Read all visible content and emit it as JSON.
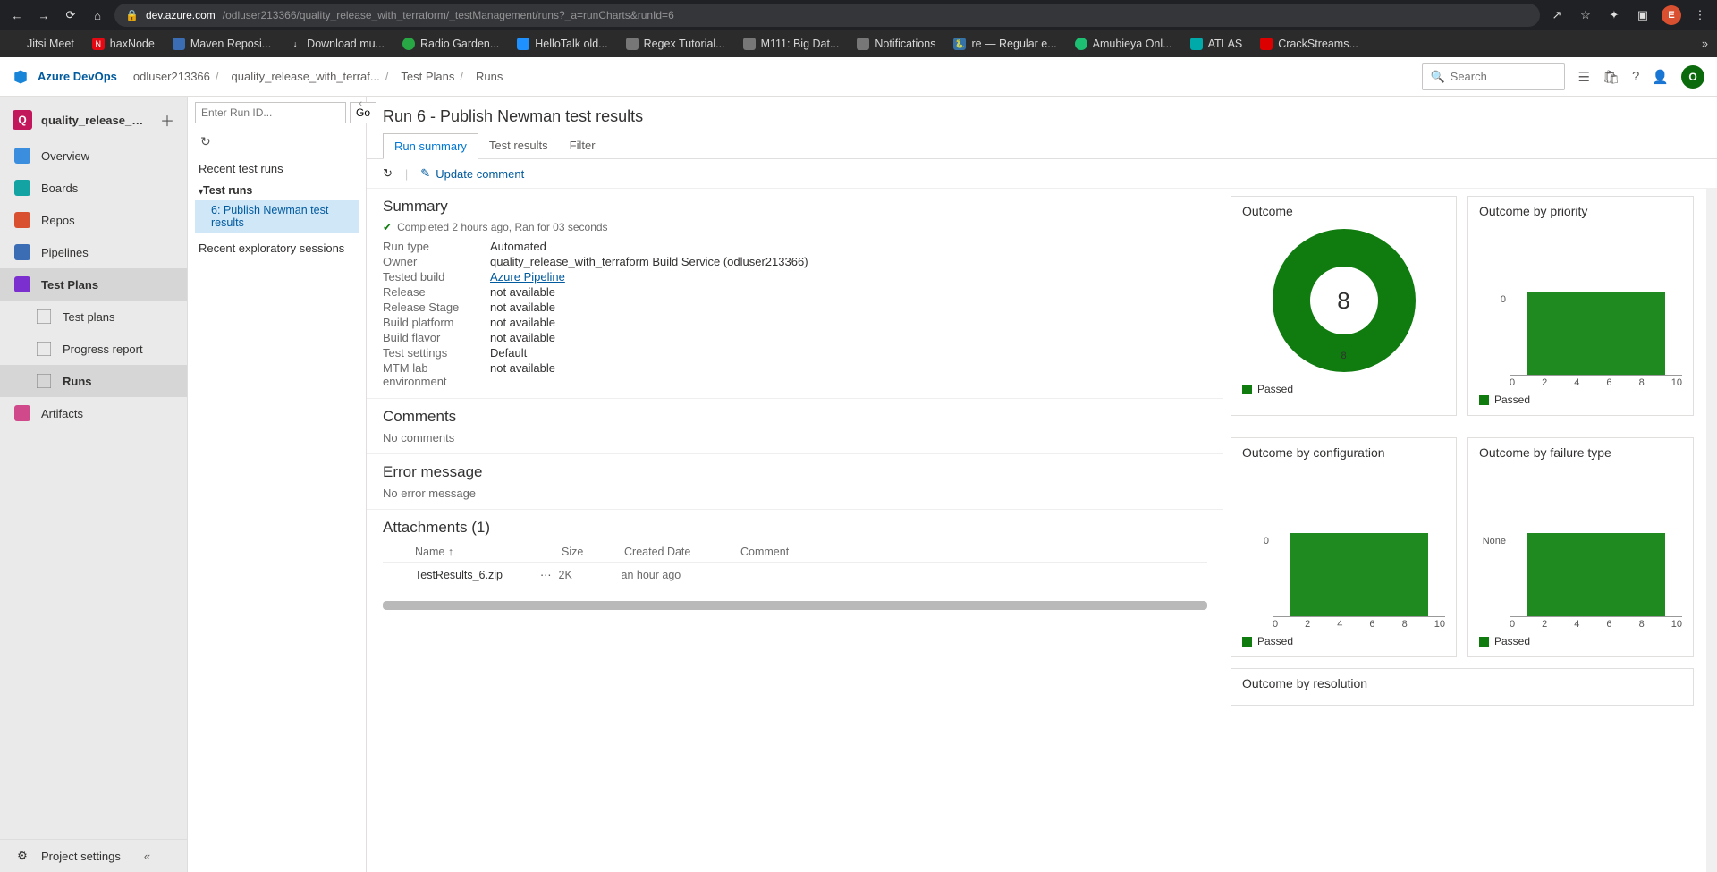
{
  "browser": {
    "url_host": "dev.azure.com",
    "url_path": "/odluser213366/quality_release_with_terraform/_testManagement/runs?_a=runCharts&runId=6",
    "avatar": "E"
  },
  "bookmarks": [
    {
      "label": "Jitsi Meet",
      "color": "#2b2b2b"
    },
    {
      "label": "haxNode",
      "color": "#e50914",
      "prefix": "N"
    },
    {
      "label": "Maven Reposi...",
      "color": "#3b6db5"
    },
    {
      "label": "Download mu...",
      "color": "#2b2b2b",
      "prefix": "↓"
    },
    {
      "label": "Radio Garden...",
      "color": "#28a745",
      "round": true
    },
    {
      "label": "HelloTalk old...",
      "color": "#1e90ff"
    },
    {
      "label": "Regex Tutorial...",
      "color": "#777"
    },
    {
      "label": "M111: Big Dat...",
      "color": "#777"
    },
    {
      "label": "Notifications",
      "color": "#777"
    },
    {
      "label": "re — Regular e...",
      "color": "#3572A5",
      "prefix": "🐍"
    },
    {
      "label": "Amubieya Onl...",
      "color": "#1dbf73",
      "round": true
    },
    {
      "label": "ATLAS",
      "color": "#0aa"
    },
    {
      "label": "CrackStreams...",
      "color": "#d00"
    }
  ],
  "header": {
    "brand": "Azure DevOps",
    "crumbs": [
      "odluser213366",
      "quality_release_with_terraf...",
      "Test Plans",
      "Runs"
    ],
    "search_placeholder": "Search",
    "avatar": "O"
  },
  "sidebar": {
    "project": "quality_release_with_t...",
    "project_initial": "Q",
    "items": [
      {
        "label": "Overview",
        "icon": "overview"
      },
      {
        "label": "Boards",
        "icon": "boards"
      },
      {
        "label": "Repos",
        "icon": "repos"
      },
      {
        "label": "Pipelines",
        "icon": "pipelines"
      },
      {
        "label": "Test Plans",
        "icon": "testplans",
        "selected": true,
        "children": [
          {
            "label": "Test plans"
          },
          {
            "label": "Progress report"
          },
          {
            "label": "Runs",
            "selected": true
          }
        ]
      },
      {
        "label": "Artifacts",
        "icon": "artifacts"
      }
    ],
    "settings": "Project settings"
  },
  "runsPanel": {
    "placeholder": "Enter Run ID...",
    "go": "Go",
    "recent": "Recent test runs",
    "sect": "Test runs",
    "item": "6: Publish Newman test results",
    "exploratory": "Recent exploratory sessions"
  },
  "page": {
    "title": "Run 6 - Publish Newman test results",
    "tabs": [
      "Run summary",
      "Test results",
      "Filter"
    ],
    "update": "Update comment",
    "summaryTitle": "Summary",
    "status": "Completed 2 hours ago, Ran for 03 seconds",
    "kv": [
      {
        "k": "Run type",
        "v": "Automated"
      },
      {
        "k": "Owner",
        "v": "quality_release_with_terraform Build Service (odluser213366)"
      },
      {
        "k": "Tested build",
        "v": "Azure Pipeline",
        "link": true
      },
      {
        "k": "Release",
        "v": "not available"
      },
      {
        "k": "Release Stage",
        "v": "not available"
      },
      {
        "k": "Build platform",
        "v": "not available"
      },
      {
        "k": "Build flavor",
        "v": "not available"
      },
      {
        "k": "Test settings",
        "v": "Default"
      },
      {
        "k": "MTM lab environment",
        "v": "not available"
      }
    ],
    "commentsTitle": "Comments",
    "commentsEmpty": "No comments",
    "errorTitle": "Error message",
    "errorEmpty": "No error message",
    "attTitle": "Attachments (1)",
    "attCols": {
      "name": "Name ↑",
      "size": "Size",
      "date": "Created Date",
      "comm": "Comment"
    },
    "attRows": [
      {
        "name": "TestResults_6.zip",
        "size": "2K",
        "date": "an hour ago",
        "comm": ""
      }
    ]
  },
  "charts": {
    "outcome": {
      "title": "Outcome",
      "total": "8",
      "label": "8",
      "legend": "Passed"
    },
    "priority": {
      "title": "Outcome by priority",
      "y": "0",
      "legend": "Passed"
    },
    "config": {
      "title": "Outcome by configuration",
      "y": "0",
      "legend": "Passed"
    },
    "failtype": {
      "title": "Outcome by failure type",
      "y": "None",
      "legend": "Passed"
    },
    "resolution": {
      "title": "Outcome by resolution"
    },
    "xticks": [
      "0",
      "2",
      "4",
      "6",
      "8",
      "10"
    ]
  },
  "chart_data": [
    {
      "type": "pie",
      "title": "Outcome",
      "series": [
        {
          "name": "Passed",
          "value": 8
        }
      ],
      "total": 8
    },
    {
      "type": "bar",
      "title": "Outcome by priority",
      "categories": [
        "0"
      ],
      "series": [
        {
          "name": "Passed",
          "values": [
            8
          ]
        }
      ],
      "xlim": [
        0,
        10
      ]
    },
    {
      "type": "bar",
      "title": "Outcome by configuration",
      "categories": [
        "0"
      ],
      "series": [
        {
          "name": "Passed",
          "values": [
            8
          ]
        }
      ],
      "xlim": [
        0,
        10
      ]
    },
    {
      "type": "bar",
      "title": "Outcome by failure type",
      "categories": [
        "None"
      ],
      "series": [
        {
          "name": "Passed",
          "values": [
            8
          ]
        }
      ],
      "xlim": [
        0,
        10
      ]
    }
  ]
}
